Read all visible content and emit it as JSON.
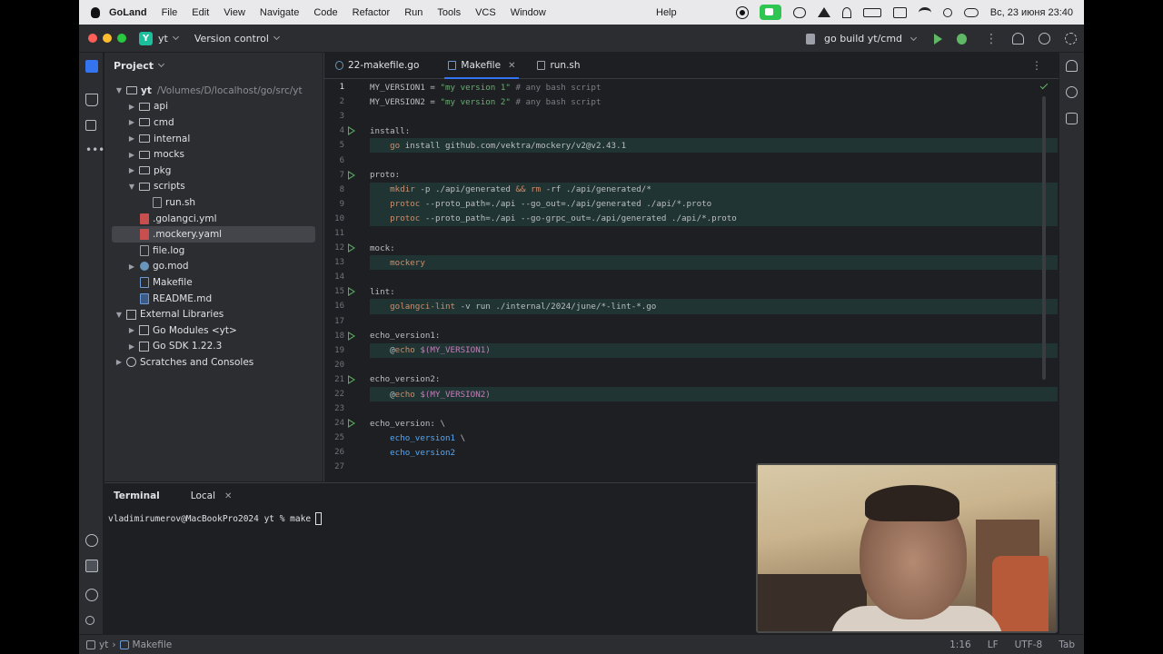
{
  "menubar": {
    "app_name": "GoLand",
    "items": [
      "File",
      "Edit",
      "View",
      "Navigate",
      "Code",
      "Refactor",
      "Run",
      "Tools",
      "VCS",
      "Window"
    ],
    "help": "Help",
    "datetime": "Вс, 23 июня  23:40",
    "status_icons": [
      "record-icon",
      "facetime-icon",
      "cloud-icon",
      "telegram-icon",
      "vpn-icon",
      "battery-icon",
      "keyboard-layout-icon",
      "wifi-icon",
      "search-icon",
      "control-center-icon"
    ]
  },
  "titlebar": {
    "project_badge": "Y",
    "project_name": "yt",
    "vcs": "Version control",
    "run_config": "go build yt/cmd"
  },
  "project_panel": {
    "title": "Project",
    "root_name": "yt",
    "root_path": "/Volumes/D/localhost/go/src/yt",
    "items": [
      {
        "label": "api",
        "depth": 1,
        "kind": "folder",
        "arrow": "▶"
      },
      {
        "label": "cmd",
        "depth": 1,
        "kind": "folder",
        "arrow": "▶"
      },
      {
        "label": "internal",
        "depth": 1,
        "kind": "folder",
        "arrow": "▶"
      },
      {
        "label": "mocks",
        "depth": 1,
        "kind": "folder",
        "arrow": "▶"
      },
      {
        "label": "pkg",
        "depth": 1,
        "kind": "folder",
        "arrow": "▶"
      },
      {
        "label": "scripts",
        "depth": 1,
        "kind": "folder",
        "arrow": "▼"
      },
      {
        "label": "run.sh",
        "depth": 2,
        "kind": "file",
        "arrow": ""
      },
      {
        "label": ".golangci.yml",
        "depth": 1,
        "kind": "yaml",
        "arrow": ""
      },
      {
        "label": ".mockery.yaml",
        "depth": 1,
        "kind": "yaml",
        "arrow": "",
        "selected": true
      },
      {
        "label": "file.log",
        "depth": 1,
        "kind": "file",
        "arrow": ""
      },
      {
        "label": "go.mod",
        "depth": 1,
        "kind": "go",
        "arrow": "▶"
      },
      {
        "label": "Makefile",
        "depth": 1,
        "kind": "make",
        "arrow": ""
      },
      {
        "label": "README.md",
        "depth": 1,
        "kind": "md",
        "arrow": ""
      }
    ],
    "external_libraries": "External Libraries",
    "lib_items": [
      "Go Modules <yt>",
      "Go SDK 1.22.3"
    ],
    "scratches": "Scratches and Consoles"
  },
  "editor": {
    "tabs": [
      {
        "label": "22-makefile.go",
        "active": false
      },
      {
        "label": "Makefile",
        "active": true
      },
      {
        "label": "run.sh",
        "active": false
      }
    ],
    "lines": [
      {
        "n": "1",
        "run": false,
        "hl": false,
        "tokens": [
          {
            "t": "MY_VERSION1 = ",
            "c": "tgt"
          },
          {
            "t": "\"my version 1\"",
            "c": "str"
          },
          {
            "t": " # any bash script",
            "c": "com"
          }
        ]
      },
      {
        "n": "2",
        "run": false,
        "hl": false,
        "tokens": [
          {
            "t": "MY_VERSION2 = ",
            "c": "tgt"
          },
          {
            "t": "\"my version 2\"",
            "c": "str"
          },
          {
            "t": " # any bash script",
            "c": "com"
          }
        ]
      },
      {
        "n": "3",
        "run": false,
        "hl": false,
        "tokens": []
      },
      {
        "n": "4",
        "run": true,
        "hl": false,
        "tokens": [
          {
            "t": "install:",
            "c": "tgt"
          }
        ]
      },
      {
        "n": "5",
        "run": false,
        "hl": true,
        "tokens": [
          {
            "t": "    ",
            "c": "tgt"
          },
          {
            "t": "go",
            "c": "cmd"
          },
          {
            "t": " install github.com/vektra/mockery/v2@v2.43.1",
            "c": "tgt"
          }
        ]
      },
      {
        "n": "6",
        "run": false,
        "hl": false,
        "tokens": []
      },
      {
        "n": "7",
        "run": true,
        "hl": false,
        "tokens": [
          {
            "t": "proto:",
            "c": "tgt"
          }
        ]
      },
      {
        "n": "8",
        "run": false,
        "hl": true,
        "tokens": [
          {
            "t": "    ",
            "c": "tgt"
          },
          {
            "t": "mkdir",
            "c": "cmd"
          },
          {
            "t": " -p ./api/generated ",
            "c": "tgt"
          },
          {
            "t": "&&",
            "c": "cmd"
          },
          {
            "t": " ",
            "c": "tgt"
          },
          {
            "t": "rm",
            "c": "cmd"
          },
          {
            "t": " -rf ./api/generated/*",
            "c": "tgt"
          }
        ]
      },
      {
        "n": "9",
        "run": false,
        "hl": true,
        "tokens": [
          {
            "t": "    ",
            "c": "tgt"
          },
          {
            "t": "protoc",
            "c": "cmd"
          },
          {
            "t": " --proto_path=./api --go_out=./api/generated ./api/*.proto",
            "c": "tgt"
          }
        ]
      },
      {
        "n": "10",
        "run": false,
        "hl": true,
        "tokens": [
          {
            "t": "    ",
            "c": "tgt"
          },
          {
            "t": "protoc",
            "c": "cmd"
          },
          {
            "t": " --proto_path=./api --go-grpc_out=./api/generated ./api/*.proto",
            "c": "tgt"
          }
        ]
      },
      {
        "n": "11",
        "run": false,
        "hl": false,
        "tokens": []
      },
      {
        "n": "12",
        "run": true,
        "hl": false,
        "tokens": [
          {
            "t": "mock:",
            "c": "tgt"
          }
        ]
      },
      {
        "n": "13",
        "run": false,
        "hl": true,
        "tokens": [
          {
            "t": "    ",
            "c": "tgt"
          },
          {
            "t": "mockery",
            "c": "cmd"
          }
        ]
      },
      {
        "n": "14",
        "run": false,
        "hl": false,
        "tokens": []
      },
      {
        "n": "15",
        "run": true,
        "hl": false,
        "tokens": [
          {
            "t": "lint:",
            "c": "tgt"
          }
        ]
      },
      {
        "n": "16",
        "run": false,
        "hl": true,
        "tokens": [
          {
            "t": "    ",
            "c": "tgt"
          },
          {
            "t": "golangci-lint",
            "c": "cmd"
          },
          {
            "t": " -v run ./internal/2024/june/*-lint-*.go",
            "c": "tgt"
          }
        ]
      },
      {
        "n": "17",
        "run": false,
        "hl": false,
        "tokens": []
      },
      {
        "n": "18",
        "run": true,
        "hl": false,
        "tokens": [
          {
            "t": "echo_version1:",
            "c": "tgt"
          }
        ]
      },
      {
        "n": "19",
        "run": false,
        "hl": true,
        "tokens": [
          {
            "t": "    @",
            "c": "tgt"
          },
          {
            "t": "echo",
            "c": "cmd"
          },
          {
            "t": " $(MY_VERSION1)",
            "c": "var"
          }
        ]
      },
      {
        "n": "20",
        "run": false,
        "hl": false,
        "tokens": []
      },
      {
        "n": "21",
        "run": true,
        "hl": false,
        "tokens": [
          {
            "t": "echo_version2:",
            "c": "tgt"
          }
        ]
      },
      {
        "n": "22",
        "run": false,
        "hl": true,
        "tokens": [
          {
            "t": "    @",
            "c": "tgt"
          },
          {
            "t": "echo",
            "c": "cmd"
          },
          {
            "t": " $(MY_VERSION2)",
            "c": "var"
          }
        ]
      },
      {
        "n": "23",
        "run": false,
        "hl": false,
        "tokens": []
      },
      {
        "n": "24",
        "run": true,
        "hl": false,
        "tokens": [
          {
            "t": "echo_version: \\",
            "c": "tgt"
          }
        ]
      },
      {
        "n": "25",
        "run": false,
        "hl": false,
        "tokens": [
          {
            "t": "    ",
            "c": "tgt"
          },
          {
            "t": "echo_version1",
            "c": "kw"
          },
          {
            "t": " \\",
            "c": "tgt"
          }
        ]
      },
      {
        "n": "26",
        "run": false,
        "hl": false,
        "tokens": [
          {
            "t": "    ",
            "c": "tgt"
          },
          {
            "t": "echo_version2",
            "c": "kw"
          }
        ]
      },
      {
        "n": "27",
        "run": false,
        "hl": false,
        "tokens": []
      }
    ]
  },
  "terminal": {
    "title": "Terminal",
    "tab": "Local",
    "prompt": "vladimirumerov@MacBookPro2024 yt % make"
  },
  "statusbar": {
    "breadcrumb_root": "yt",
    "breadcrumb_file": "Makefile",
    "position": "1:16",
    "line_sep": "LF",
    "encoding": "UTF-8",
    "indent": "Tab"
  }
}
